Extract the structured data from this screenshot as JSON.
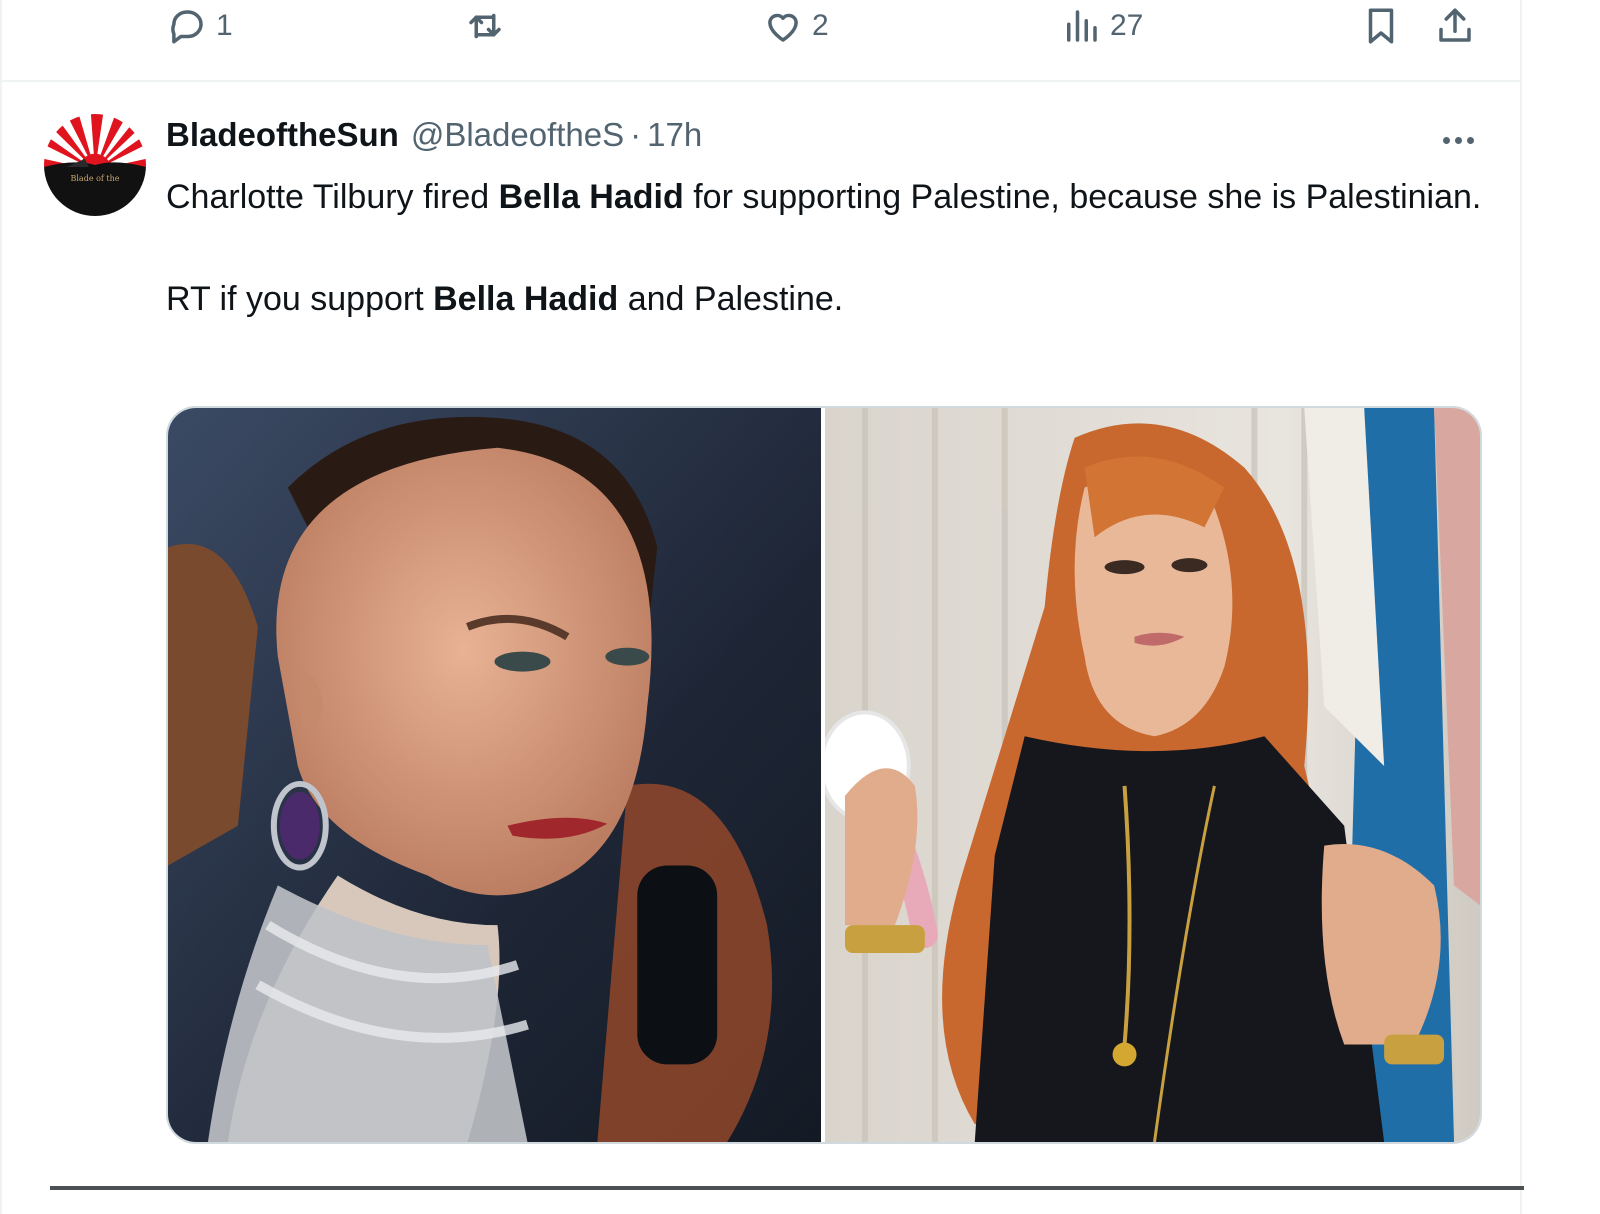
{
  "previous_tweet": {
    "actions": {
      "reply_count": "1",
      "retweet_count": "",
      "like_count": "2",
      "views_count": "27"
    }
  },
  "tweet": {
    "author": {
      "display_name": "BladeoftheSun",
      "handle": "@BladeoftheS",
      "avatar_text": "Blade of the"
    },
    "separator": "·",
    "time": "17h",
    "text": {
      "p1_a": "Charlotte Tilbury fired ",
      "p1_bold": "Bella Hadid",
      "p1_b": " for supporting Palestine, because she is Palestinian.",
      "p2_a": "RT if you support ",
      "p2_bold": "Bella Hadid",
      "p2_b": " and Palestine."
    },
    "media": [
      {
        "icon": "photo-bella-hadid"
      },
      {
        "icon": "photo-charlotte-tilbury"
      }
    ]
  },
  "colors": {
    "text_primary": "#0f1419",
    "text_secondary": "#536471",
    "border": "#eff3f4",
    "avatar_red": "#e0141e"
  }
}
